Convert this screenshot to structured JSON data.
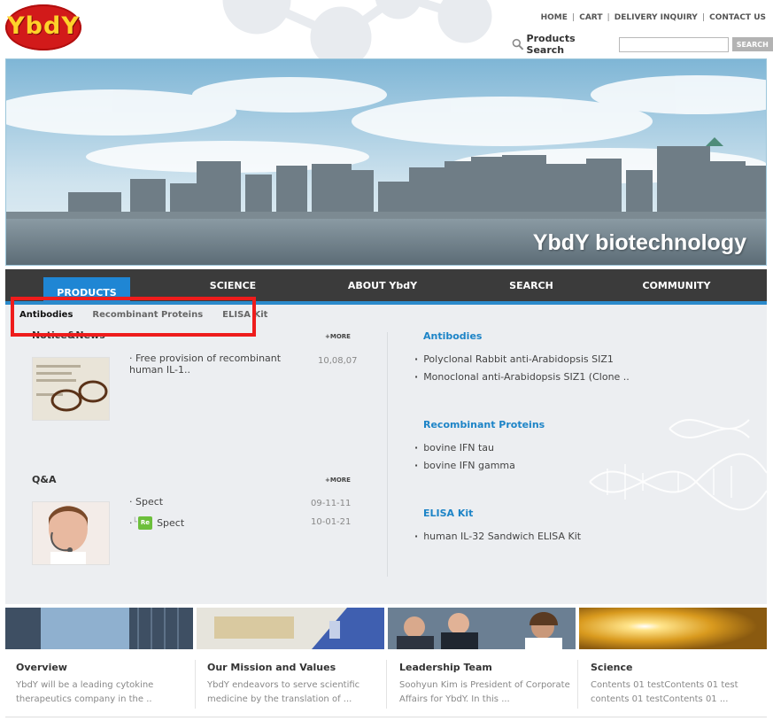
{
  "header": {
    "logo_text": "YbdY",
    "top_links": [
      "HOME",
      "CART",
      "DELIVERY INQUIRY",
      "CONTACT US"
    ],
    "search_label": "Products Search",
    "search_button": "SEARCH"
  },
  "banner": {
    "title": "YbdY biotechnology"
  },
  "nav": {
    "items": [
      "PRODUCTS",
      "SCIENCE",
      "ABOUT YbdY",
      "SEARCH",
      "COMMUNITY"
    ]
  },
  "subnav": {
    "items": [
      "Antibodies",
      "Recombinant Proteins",
      "ELISA Kit"
    ]
  },
  "notice": {
    "title": "Notice&News",
    "more": "+MORE",
    "items": [
      {
        "text": "Free provision of recombinant human IL-1..",
        "date": "10,08,07"
      }
    ]
  },
  "qa": {
    "title": "Q&A",
    "more": "+MORE",
    "items": [
      {
        "text": "Spect",
        "date": "09-11-11"
      },
      {
        "text": "Spect",
        "date": "10-01-21",
        "badge": "Re"
      }
    ]
  },
  "categories": [
    {
      "title": "Antibodies",
      "items": [
        "Polyclonal Rabbit anti-Arabidopsis SIZ1",
        "Monoclonal anti-Arabidopsis SIZ1 (Clone .."
      ]
    },
    {
      "title": "Recombinant Proteins",
      "items": [
        "bovine IFN tau",
        "bovine IFN gamma"
      ]
    },
    {
      "title": "ELISA Kit",
      "items": [
        "human IL-32 Sandwich ELISA Kit"
      ]
    }
  ],
  "cards": [
    {
      "title": "Overview",
      "desc": "YbdY will be a leading cytokine therapeutics company in the .."
    },
    {
      "title": "Our Mission and Values",
      "desc": "YbdY endeavors to serve scientific medicine by the translation of ..."
    },
    {
      "title": "Leadership Team",
      "desc": "Soohyun Kim is President of Corporate Affairs for YbdY. In this ..."
    },
    {
      "title": "Science",
      "desc": "Contents 01 testContents 01 test contents 01 testContents 01 ..."
    }
  ],
  "colors": {
    "accent_blue": "#1f86d4",
    "link_blue": "#1d84c7",
    "logo_red": "#d21a1a",
    "logo_yellow": "#ffd22a",
    "nav_dark": "#3b3b3b",
    "highlight_red": "#ee1c1c"
  }
}
